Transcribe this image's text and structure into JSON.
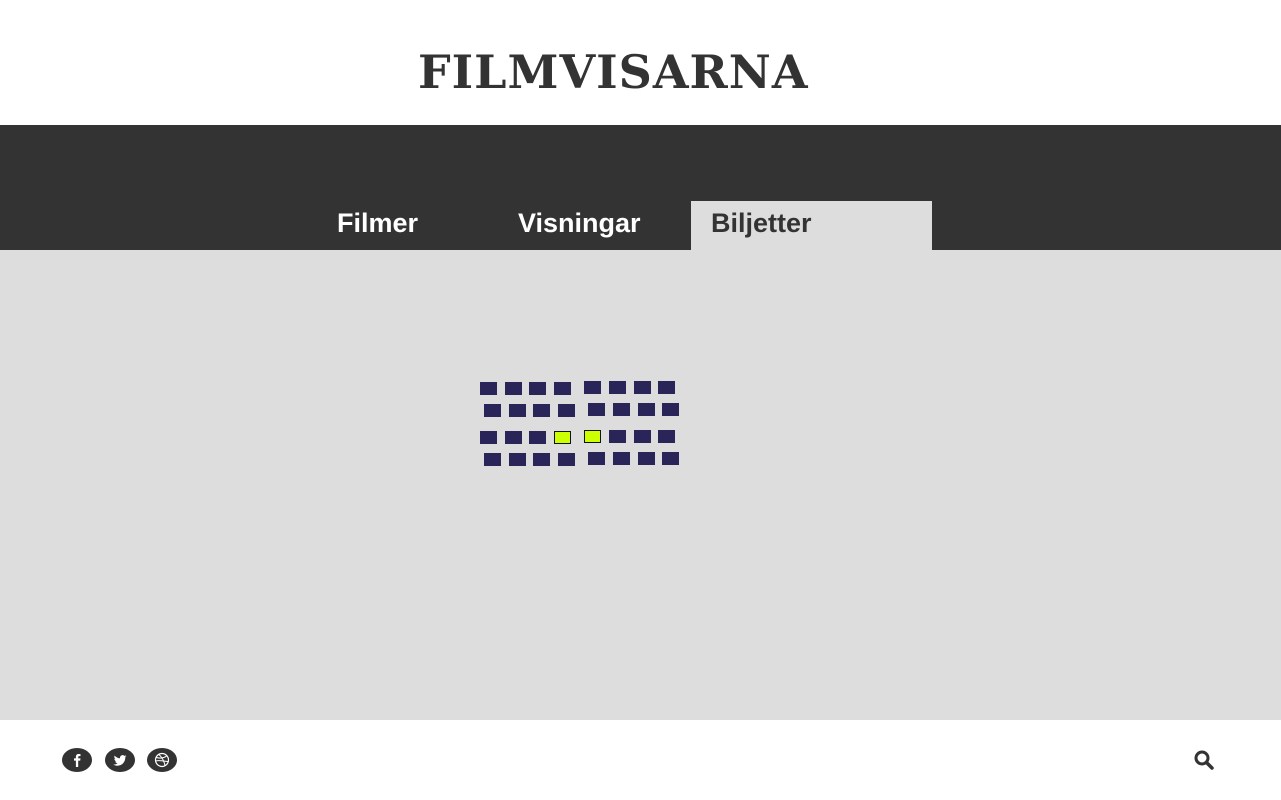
{
  "header": {
    "logo": "FILMVISARNA"
  },
  "nav": {
    "tabs": [
      {
        "label": "Filmer",
        "active": false
      },
      {
        "label": "Visningar",
        "active": false
      },
      {
        "label": "Biljetter",
        "active": true
      }
    ]
  },
  "seating": {
    "rows": [
      {
        "seats": [
          0,
          0,
          0,
          0,
          0,
          0,
          0,
          0
        ]
      },
      {
        "seats": [
          0,
          0,
          0,
          0,
          0,
          0,
          0,
          0
        ]
      },
      {
        "seats": [
          0,
          0,
          0,
          1,
          1,
          0,
          0,
          0
        ]
      },
      {
        "seats": [
          0,
          0,
          0,
          0,
          0,
          0,
          0,
          0
        ]
      }
    ],
    "colors": {
      "available": "#2a2558",
      "selected": "#ccff00"
    }
  },
  "footer": {
    "social_icons": [
      "facebook-icon",
      "twitter-icon",
      "dribbble-icon"
    ],
    "search_icon": "search-icon"
  },
  "colors": {
    "nav_background": "#333333",
    "content_background": "#dddddd",
    "logo_text": "#333333"
  }
}
